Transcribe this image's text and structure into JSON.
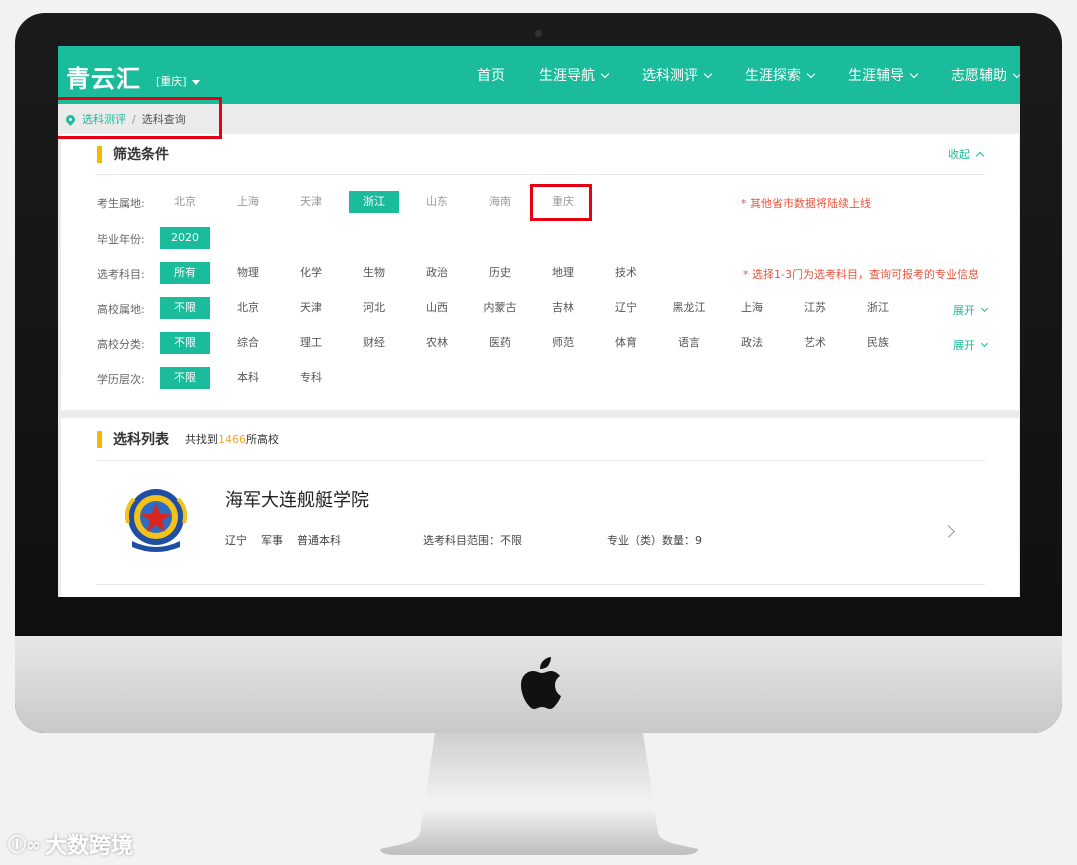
{
  "header": {
    "logo": "青云汇",
    "city": "[重庆]",
    "menu": [
      "首页",
      "生涯导航",
      "选科测评",
      "生涯探索",
      "生涯辅导",
      "志愿辅助"
    ]
  },
  "breadcrumb": {
    "current_section": "选科测评",
    "separator": "/",
    "page": "选科查询"
  },
  "filters": {
    "title": "筛选条件",
    "collapse_label": "收起",
    "expand_label": "展开",
    "province": {
      "label": "考生属地:",
      "options": [
        "北京",
        "上海",
        "天津",
        "浙江",
        "山东",
        "海南",
        "重庆"
      ],
      "selected": "浙江",
      "note": "* 其他省市数据将陆续上线"
    },
    "year": {
      "label": "毕业年份:",
      "options": [
        "2020"
      ],
      "selected": "2020"
    },
    "subjects": {
      "label": "选考科目:",
      "options": [
        "所有",
        "物理",
        "化学",
        "生物",
        "政治",
        "历史",
        "地理",
        "技术"
      ],
      "selected": "所有",
      "note": "* 选择1-3门为选考科目，查询可报考的专业信息"
    },
    "school_location": {
      "label": "高校属地:",
      "options": [
        "不限",
        "北京",
        "天津",
        "河北",
        "山西",
        "内蒙古",
        "吉林",
        "辽宁",
        "黑龙江",
        "上海",
        "江苏",
        "浙江"
      ],
      "selected": "不限"
    },
    "school_type": {
      "label": "高校分类:",
      "options": [
        "不限",
        "综合",
        "理工",
        "财经",
        "农林",
        "医药",
        "师范",
        "体育",
        "语言",
        "政法",
        "艺术",
        "民族"
      ],
      "selected": "不限"
    },
    "education_level": {
      "label": "学历层次:",
      "options": [
        "不限",
        "本科",
        "专科"
      ],
      "selected": "不限"
    }
  },
  "list": {
    "title": "选科列表",
    "count_prefix": "共找到",
    "count": "1466",
    "count_suffix": "所高校",
    "items": [
      {
        "name": "海军大连舰艇学院",
        "province": "辽宁",
        "category": "军事",
        "level": "普通本科",
        "subject_range": "选考科目范围：不限",
        "major_count": "专业（类）数量：9"
      }
    ]
  },
  "watermark": "大数跨境",
  "colors": {
    "primary": "#1bbc9b",
    "accent_bar": "#f5b700",
    "note_red": "#e8533f",
    "highlight_box": "#e60012",
    "count_orange": "#f5a623"
  }
}
